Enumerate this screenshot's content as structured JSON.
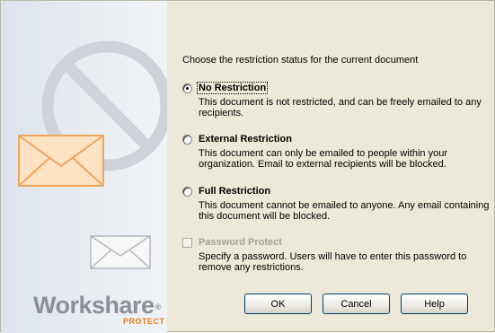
{
  "brand": {
    "name": "Workshare",
    "mark": "®",
    "product": "PROTECT"
  },
  "prompt": "Choose the restriction status for the current document",
  "options": [
    {
      "label": "No Restriction",
      "selected": true,
      "description": "This document is not restricted, and can be freely emailed to any recipients."
    },
    {
      "label": "External Restriction",
      "selected": false,
      "description": "This document can only be emailed to people within your organization. Email to external recipients will be blocked."
    },
    {
      "label": "Full Restriction",
      "selected": false,
      "description": "This document cannot be emailed to anyone. Any email containing this document will be blocked."
    }
  ],
  "password": {
    "label": "Password Protect",
    "checked": false,
    "enabled": false,
    "description": "Specify a password. Users will have to enter this password to remove any restrictions."
  },
  "buttons": {
    "ok": "OK",
    "cancel": "Cancel",
    "help": "Help"
  },
  "colors": {
    "brand_gray": "#8b8f96",
    "brand_orange": "#e37a1f",
    "button_border": "#003c74"
  }
}
